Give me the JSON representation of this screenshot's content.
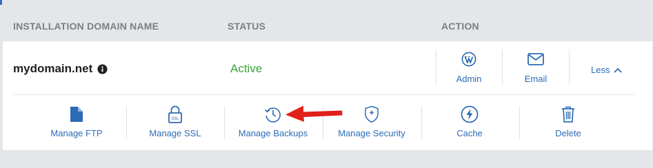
{
  "colors": {
    "accent_blue": "#2d6bb5",
    "status_active": "#3aa53a",
    "arrow_red": "#e0201a",
    "header_gray": "#7d7f86",
    "page_bg": "#e5e6ea"
  },
  "table": {
    "headers": {
      "domain": "INSTALLATION DOMAIN NAME",
      "status": "STATUS",
      "action": "ACTION"
    }
  },
  "row": {
    "domain": "mydomain.net",
    "domain_icon": "info-icon",
    "status": "Active",
    "actions": [
      {
        "label": "Admin",
        "icon": "wordpress-icon"
      },
      {
        "label": "Email",
        "icon": "envelope-icon"
      }
    ],
    "toggle_label": "Less",
    "toggle_icon": "chevron-up-icon"
  },
  "expanded_actions": [
    {
      "label": "Manage FTP",
      "icon": "file-icon"
    },
    {
      "label": "Manage SSL",
      "icon": "ssl-lock-icon"
    },
    {
      "label": "Manage Backups",
      "icon": "backup-history-icon"
    },
    {
      "label": "Manage Security",
      "icon": "shield-plus-icon"
    },
    {
      "label": "Cache",
      "icon": "bolt-icon"
    },
    {
      "label": "Delete",
      "icon": "trash-icon"
    }
  ],
  "annotation": {
    "icon": "red-arrow-icon"
  }
}
